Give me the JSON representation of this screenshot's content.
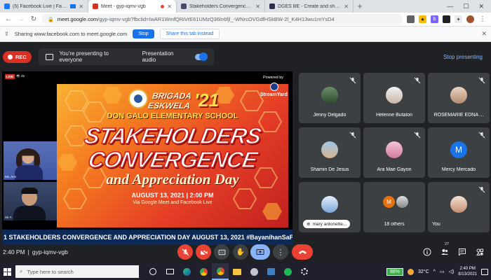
{
  "browser": {
    "tabs": [
      {
        "label": "(5) Facebook Live | Facebook",
        "favicon_color": "#1877f2",
        "active": false
      },
      {
        "label": "Meet - gyp-iqmv-vgb",
        "favicon_color": "#d93025",
        "active": true,
        "recording": true
      },
      {
        "label": "Stakeholders Convergence - Pro",
        "favicon_color": "#4a4a6a",
        "active": false
      },
      {
        "label": "DGES BE - Create and share you",
        "favicon_color": "#2d2d4e",
        "active": false
      }
    ],
    "new_tab_label": "+",
    "url_host": "meet.google.com",
    "url_path": "/gyp-iqmv-vgb?fbclid=IwAR1WmfQRiVrE61UMzQ36ln6fjl_-WNrcOVGdfHSkBW-2l_K4H13wu1mYsD4"
  },
  "sharebar": {
    "text": "Sharing www.facebook.com to meet.google.com",
    "stop_label": "Stop",
    "hide_label": "Share this tab instead"
  },
  "meet": {
    "rec_label": "REC",
    "presenting_text": "You're presenting to everyone",
    "audio_label": "Presentation audio",
    "stop_presenting": "Stop presenting",
    "time": "2:40 PM",
    "separator": "|",
    "meeting_code": "gyp-iqmv-vgb",
    "participant_count": "27"
  },
  "stream": {
    "powered_by": "Powered by",
    "streamyard": "StreamYard",
    "live_tag": "LIVE",
    "cam1_label": "Ms. Ann",
    "cam2_label": "Sir A",
    "slide": {
      "brigada": "BRIGADA",
      "eskwela": "ESKWELA",
      "year": "'21",
      "school": "DON GALO ELEMENTARY SCHOOL",
      "line1": "STAKEHOLDERS",
      "line2": "CONVERGENCE",
      "line3": "and Appreciation Day",
      "date": "AUGUST 13, 2021  |  2:00 PM",
      "via": "Via Google Meet and Facebook Live"
    },
    "ticker": "1 STAKEHOLDERS CONVERGENCE AND APPRECIATION DAY AUGUST 13, 2021 #BayanihanSaPa"
  },
  "participants": [
    {
      "name": "Jenny Delgado"
    },
    {
      "name": "Helenne Butalon"
    },
    {
      "name": "ROSEMARIE EDNA ..."
    },
    {
      "name": "Shamin De Jesus"
    },
    {
      "name": "Ara Mae Gayon"
    },
    {
      "name": "Mercy Mercado",
      "initial": "M"
    },
    {
      "name": "mary antonette..."
    },
    {
      "name": "18 others",
      "initial": "M"
    },
    {
      "name": "You"
    }
  ],
  "taskbar": {
    "search_placeholder": "Type here to search",
    "battery": "88%",
    "temperature": "32°C",
    "clock_time": "2:40 PM",
    "clock_date": "8/13/2021"
  },
  "colors": {
    "meet_bg": "#202124",
    "tile_bg": "#3c4043",
    "accent_blue": "#1a73e8",
    "danger_red": "#ea4335",
    "ticker_bg": "#0d2a57"
  }
}
